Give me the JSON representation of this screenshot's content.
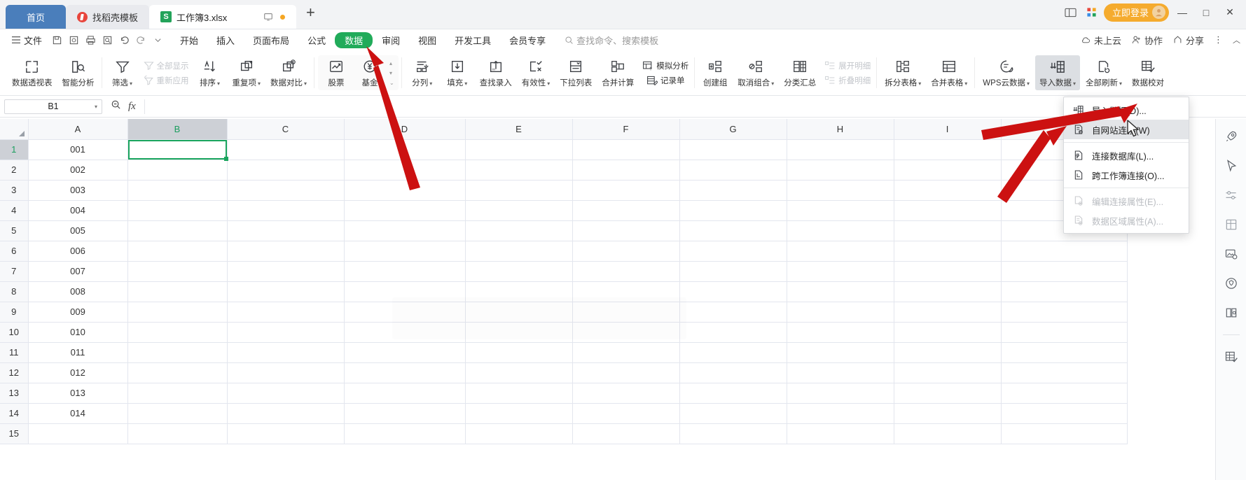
{
  "window": {
    "tabs": [
      {
        "label": "首页",
        "type": "home"
      },
      {
        "label": "找稻壳模板",
        "type": "template"
      },
      {
        "label": "工作簿3.xlsx",
        "type": "document",
        "active": true
      }
    ],
    "new_tab_label": "+",
    "login_label": "立即登录",
    "minimize": "—",
    "maximize": "□",
    "close": "✕"
  },
  "menubar": {
    "file_label": "文件",
    "quick_icons": [
      "save-icon",
      "print-preview-icon",
      "print-icon",
      "find-icon",
      "undo-icon",
      "redo-icon",
      "customize-caret-icon"
    ],
    "tabs": [
      {
        "label": "开始"
      },
      {
        "label": "插入"
      },
      {
        "label": "页面布局"
      },
      {
        "label": "公式"
      },
      {
        "label": "数据",
        "selected": true
      },
      {
        "label": "审阅"
      },
      {
        "label": "视图"
      },
      {
        "label": "开发工具"
      },
      {
        "label": "会员专享"
      }
    ],
    "search_placeholder": "查找命令、搜索模板",
    "right": [
      {
        "label": "未上云",
        "icon": "cloud-off-icon"
      },
      {
        "label": "协作",
        "icon": "collaborate-icon"
      },
      {
        "label": "分享",
        "icon": "share-icon"
      }
    ],
    "more_label": "⋮",
    "collapse_label": "︿"
  },
  "ribbon": {
    "groups": [
      {
        "name": "analysis",
        "items": [
          {
            "label": "数据透视表",
            "icon": "pivot-table-icon"
          },
          {
            "label": "智能分析",
            "icon": "smart-analysis-icon"
          }
        ]
      },
      {
        "name": "filter-sort",
        "items": [
          {
            "label": "筛选",
            "icon": "filter-icon",
            "caret": true
          },
          {
            "label": "全部显示",
            "icon": "show-all-icon",
            "disabled": true,
            "small": true
          },
          {
            "label": "重新应用",
            "icon": "reapply-icon",
            "disabled": true,
            "small": true
          },
          {
            "label": "排序",
            "icon": "sort-icon",
            "caret": true
          },
          {
            "label": "重复项",
            "icon": "duplicate-icon",
            "caret": true
          },
          {
            "label": "数据对比",
            "icon": "data-compare-icon",
            "caret": true
          }
        ]
      },
      {
        "name": "finance",
        "items": [
          {
            "label": "股票",
            "icon": "stock-icon"
          },
          {
            "label": "基金",
            "icon": "fund-icon"
          }
        ],
        "spinner": true
      },
      {
        "name": "data-tools",
        "items": [
          {
            "label": "分列",
            "icon": "split-columns-icon",
            "caret": true
          },
          {
            "label": "填充",
            "icon": "fill-icon",
            "caret": true
          },
          {
            "label": "查找录入",
            "icon": "lookup-entry-icon"
          },
          {
            "label": "有效性",
            "icon": "validation-icon",
            "caret": true
          },
          {
            "label": "下拉列表",
            "icon": "dropdown-list-icon"
          },
          {
            "label": "合并计算",
            "icon": "consolidate-icon"
          },
          {
            "label": "模拟分析",
            "icon": "what-if-icon",
            "small": true
          },
          {
            "label": "记录单",
            "icon": "record-form-icon",
            "small": true
          }
        ]
      },
      {
        "name": "outline",
        "items": [
          {
            "label": "创建组",
            "icon": "create-group-icon"
          },
          {
            "label": "取消组合",
            "icon": "ungroup-icon",
            "caret": true
          },
          {
            "label": "分类汇总",
            "icon": "subtotal-icon"
          },
          {
            "label": "展开明细",
            "icon": "expand-detail-icon",
            "disabled": true,
            "small": true
          },
          {
            "label": "折叠明细",
            "icon": "collapse-detail-icon",
            "disabled": true,
            "small": true
          }
        ]
      },
      {
        "name": "tables",
        "items": [
          {
            "label": "拆分表格",
            "icon": "split-table-icon",
            "caret": true
          },
          {
            "label": "合并表格",
            "icon": "merge-table-icon",
            "caret": true
          }
        ]
      },
      {
        "name": "import",
        "items": [
          {
            "label": "WPS云数据",
            "icon": "wps-cloud-data-icon",
            "caret": true
          },
          {
            "label": "导入数据",
            "icon": "import-data-icon",
            "caret": true,
            "selected": true
          },
          {
            "label": "全部刷新",
            "icon": "refresh-all-icon",
            "caret": true
          },
          {
            "label": "数据校对",
            "icon": "data-proofread-icon"
          }
        ]
      }
    ]
  },
  "formula_bar": {
    "name_box_value": "B1",
    "formula_value": "",
    "zoom_icon": "zoom-out-icon",
    "fx_icon": "fx-icon"
  },
  "grid": {
    "columns": [
      "A",
      "B",
      "C",
      "D",
      "E",
      "F",
      "G",
      "H",
      "I"
    ],
    "selected_column": "B",
    "selected_row": 1,
    "active_cell": "B1",
    "rows": [
      {
        "num": 1,
        "A": "001"
      },
      {
        "num": 2,
        "A": "002"
      },
      {
        "num": 3,
        "A": "003"
      },
      {
        "num": 4,
        "A": "004"
      },
      {
        "num": 5,
        "A": "005"
      },
      {
        "num": 6,
        "A": "006"
      },
      {
        "num": 7,
        "A": "007"
      },
      {
        "num": 8,
        "A": "008"
      },
      {
        "num": 9,
        "A": "009"
      },
      {
        "num": 10,
        "A": "010"
      },
      {
        "num": 11,
        "A": "011"
      },
      {
        "num": 12,
        "A": "012"
      },
      {
        "num": 13,
        "A": "013"
      },
      {
        "num": 14,
        "A": "014"
      },
      {
        "num": 15,
        "A": ""
      }
    ]
  },
  "dropdown": {
    "items": [
      {
        "label": "导入数据(D)...",
        "icon": "import-data-icon"
      },
      {
        "label": "自网站连接(W)",
        "icon": "web-connect-icon",
        "highlighted": true
      },
      {
        "separator_after": true
      },
      {
        "label": "连接数据库(L)...",
        "icon": "database-connect-icon"
      },
      {
        "label": "跨工作簿连接(O)...",
        "icon": "cross-workbook-icon"
      },
      {
        "separator_after": true
      },
      {
        "label": "编辑连接属性(E)...",
        "icon": "edit-connection-icon",
        "disabled": true
      },
      {
        "label": "数据区域属性(A)...",
        "icon": "data-range-props-icon",
        "disabled": true
      }
    ]
  },
  "sidebar": {
    "icons": [
      "rocket-icon",
      "cursor-select-icon",
      "settings-sliders-icon",
      "cell-format-icon",
      "image-tools-icon",
      "shield-badge-icon",
      "book-open-icon",
      "data-proofread-icon"
    ]
  },
  "annotations": {
    "arrow_color": "#cc1111",
    "arrows": [
      {
        "name": "arrow-to-data-tab"
      },
      {
        "name": "arrow-to-import-data-button"
      },
      {
        "name": "arrow-to-web-connect-item"
      }
    ]
  }
}
